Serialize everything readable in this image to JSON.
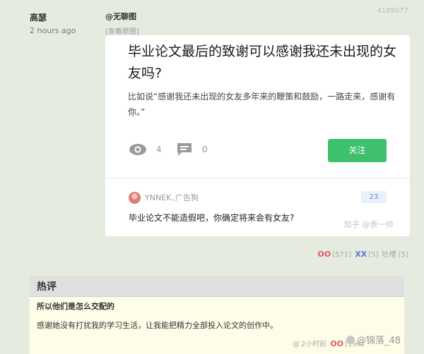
{
  "post": {
    "author": "高瑟",
    "time": "2 hours ago",
    "tag": "@无聊图",
    "view_original": "[查看原图]",
    "post_id": "4189077"
  },
  "card": {
    "question_title": "毕业论文最后的致谢可以感谢我还未出现的女友吗?",
    "question_desc": "比如说“感谢我还未出现的女友多年来的鞭策和鼓励，一路走来，感谢有你。”",
    "views": "4",
    "comments": "0",
    "follow_label": "关注",
    "answer_author": "YNNEK",
    "answer_author_tag": "广告狗",
    "answer_votes": "23",
    "answer_text": "毕业论文不能造假吧，你确定将来会有女友?",
    "watermark": "知乎 @表一帅"
  },
  "post_votes": {
    "oo_label": "OO",
    "oo_count": "[571]",
    "xx_label": "XX",
    "xx_count": "[5]",
    "tucao": "吐槽 [5]"
  },
  "hot_comments": {
    "header": "热评",
    "author": "所以他们是怎么交配的",
    "text": "感谢她没有打扰我的学习生活，让我能把精力全部投入论文的创作中。",
    "time": "2小时前",
    "oo_label": "OO",
    "oo_count": "[196]",
    "weibo_mark": "@锦落_48"
  },
  "colors": {
    "follow": "#3ec06c",
    "oo": "#e25a5a",
    "xx": "#5b75d8"
  },
  "icons": [
    "eye-icon",
    "comment-icon",
    "avatar",
    "weibo-icon"
  ]
}
